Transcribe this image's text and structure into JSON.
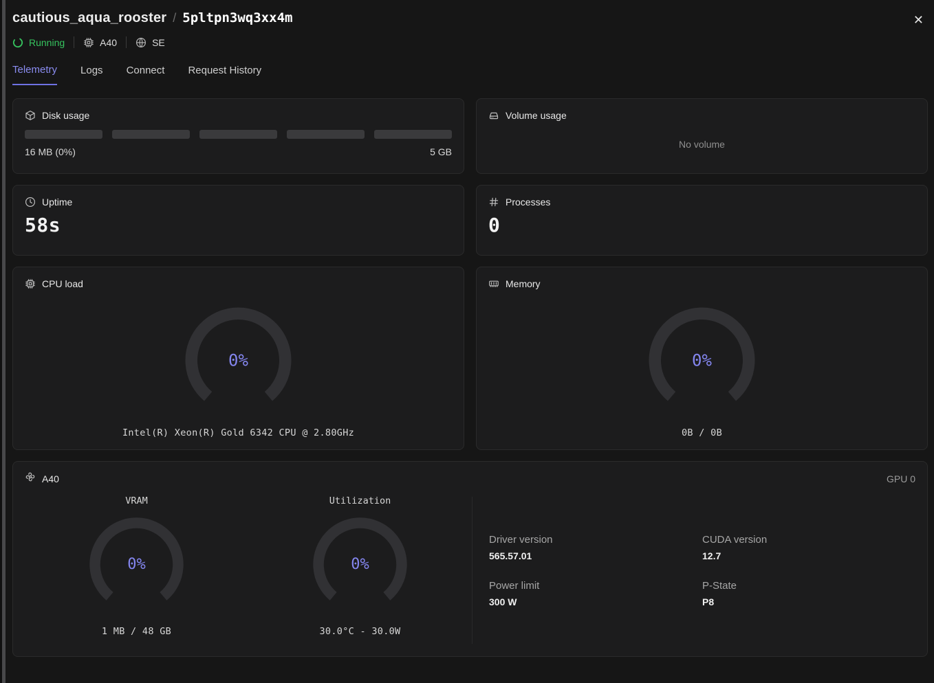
{
  "header": {
    "title": "cautious_aqua_rooster",
    "separator": "/",
    "instance_id": "5pltpn3wq3xx4m"
  },
  "icons": {
    "close": "✕",
    "names": [
      "spinner-icon",
      "chip-icon",
      "globe-icon",
      "box-icon",
      "hard-drive-icon",
      "clock-icon",
      "hash-icon",
      "memory-icon",
      "gpu-fan-icon",
      "close-icon"
    ]
  },
  "status": {
    "state": "Running",
    "gpu_type": "A40",
    "region": "SE"
  },
  "tabs": [
    {
      "label": "Telemetry",
      "active": true
    },
    {
      "label": "Logs",
      "active": false
    },
    {
      "label": "Connect",
      "active": false
    },
    {
      "label": "Request History",
      "active": false
    }
  ],
  "cards": {
    "disk": {
      "title": "Disk usage",
      "used": "16 MB (0%)",
      "total": "5 GB",
      "segments": 5
    },
    "volume": {
      "title": "Volume usage",
      "empty_text": "No volume"
    },
    "uptime": {
      "title": "Uptime",
      "value": "58s"
    },
    "processes": {
      "title": "Processes",
      "value": "0"
    },
    "cpu": {
      "title": "CPU load",
      "percent": "0%",
      "model": "Intel(R) Xeon(R) Gold 6342 CPU @ 2.80GHz"
    },
    "memory": {
      "title": "Memory",
      "percent": "0%",
      "usage": "0B / 0B"
    },
    "gpu": {
      "title": "A40",
      "index_label": "GPU 0",
      "vram": {
        "label": "VRAM",
        "percent": "0%",
        "usage": "1 MB / 48 GB"
      },
      "utilization": {
        "label": "Utilization",
        "percent": "0%",
        "temp_power": "30.0°C - 30.0W"
      },
      "details": [
        {
          "label": "Driver version",
          "value": "565.57.01"
        },
        {
          "label": "CUDA version",
          "value": "12.7"
        },
        {
          "label": "Power limit",
          "value": "300 W"
        },
        {
          "label": "P-State",
          "value": "P8"
        }
      ]
    }
  },
  "colors": {
    "accent": "#8486ef",
    "running_green": "#36c45f",
    "gauge_track": "#313134",
    "card_bg": "#1c1c1d",
    "page_bg": "#161616"
  }
}
